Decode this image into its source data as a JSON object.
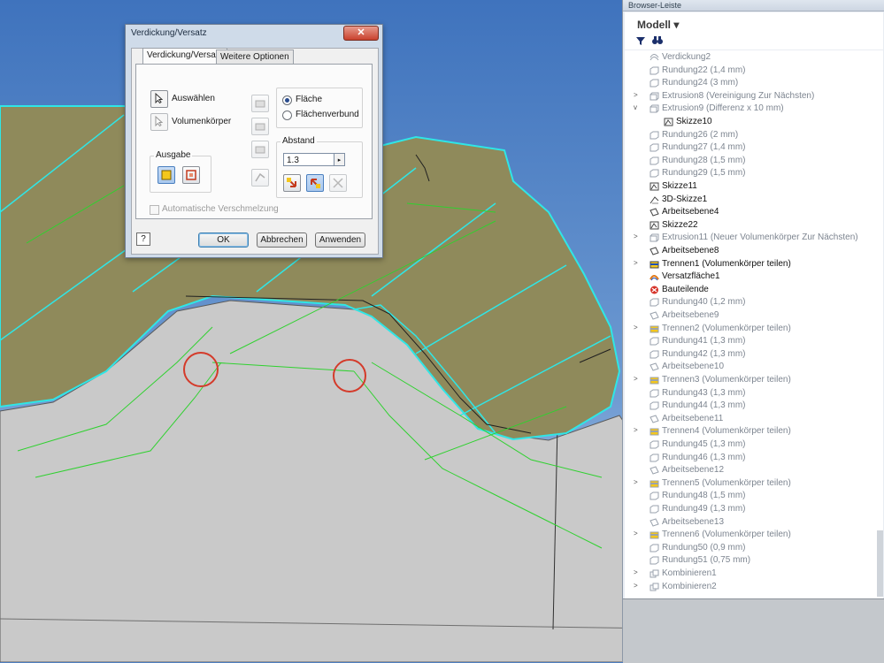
{
  "dialog": {
    "title": "Verdickung/Versatz",
    "close_glyph": "✕",
    "tabs": [
      {
        "label": "Verdickung/Versatz"
      },
      {
        "label": "Weitere Optionen"
      }
    ],
    "select_label": "Auswählen",
    "solid_label": "Volumenkörper",
    "output_group": "Ausgabe",
    "radio_face": "Fläche",
    "radio_quilt": "Flächenverbund",
    "distance_group": "Abstand",
    "distance_value": "1.3",
    "spin_glyph": "▸",
    "auto_blend": "Automatische Verschmelzung",
    "help_glyph": "?",
    "ok": "OK",
    "cancel": "Abbrechen",
    "apply": "Anwenden"
  },
  "browser": {
    "title": "Browser-Leiste",
    "model_dropdown": "Modell ▾",
    "items": [
      {
        "label": "Verdickung2",
        "icon": "thicken-icon",
        "state": "gray",
        "exp": ""
      },
      {
        "label": "Rundung22 (1,4 mm)",
        "icon": "fillet-icon",
        "state": "gray",
        "exp": ""
      },
      {
        "label": "Rundung24 (3 mm)",
        "icon": "fillet-icon",
        "state": "gray",
        "exp": ""
      },
      {
        "label": "Extrusion8 (Vereinigung Zur Nächsten)",
        "icon": "extrude-icon",
        "state": "gray",
        "exp": ">"
      },
      {
        "label": "Extrusion9 (Differenz x 10 mm)",
        "icon": "extrude-icon",
        "state": "gray",
        "exp": "v"
      },
      {
        "label": "Skizze10",
        "icon": "sketch-icon",
        "state": "normal",
        "exp": "",
        "indent": true
      },
      {
        "label": "Rundung26 (2 mm)",
        "icon": "fillet-icon",
        "state": "gray",
        "exp": ""
      },
      {
        "label": "Rundung27 (1,4 mm)",
        "icon": "fillet-icon",
        "state": "gray",
        "exp": ""
      },
      {
        "label": "Rundung28 (1,5 mm)",
        "icon": "fillet-icon",
        "state": "gray",
        "exp": ""
      },
      {
        "label": "Rundung29 (1,5 mm)",
        "icon": "fillet-icon",
        "state": "gray",
        "exp": ""
      },
      {
        "label": "Skizze11",
        "icon": "sketch-icon",
        "state": "normal",
        "exp": ""
      },
      {
        "label": "3D-Skizze1",
        "icon": "sketch3d-icon",
        "state": "normal",
        "exp": ""
      },
      {
        "label": "Arbeitsebene4",
        "icon": "workplane-icon",
        "state": "normal",
        "exp": ""
      },
      {
        "label": "Skizze22",
        "icon": "sketch-icon",
        "state": "normal",
        "exp": ""
      },
      {
        "label": "Extrusion11 (Neuer Volumenkörper Zur Nächsten)",
        "icon": "extrude-icon",
        "state": "gray",
        "exp": ">"
      },
      {
        "label": "Arbeitsebene8",
        "icon": "workplane-icon",
        "state": "normal",
        "exp": ""
      },
      {
        "label": "Trennen1 (Volumenkörper teilen)",
        "icon": "split-icon",
        "state": "normal",
        "exp": ">"
      },
      {
        "label": "Versatzfläche1",
        "icon": "offset-surface-icon",
        "state": "normal",
        "exp": ""
      },
      {
        "label": "Bauteilende",
        "icon": "end-of-part-icon",
        "state": "normal",
        "exp": ""
      },
      {
        "label": "Rundung40 (1,2 mm)",
        "icon": "fillet-icon",
        "state": "gray",
        "exp": ""
      },
      {
        "label": "Arbeitsebene9",
        "icon": "workplane-icon",
        "state": "gray",
        "exp": ""
      },
      {
        "label": "Trennen2 (Volumenkörper teilen)",
        "icon": "split-icon",
        "state": "gray",
        "exp": ">"
      },
      {
        "label": "Rundung41 (1,3 mm)",
        "icon": "fillet-icon",
        "state": "gray",
        "exp": ""
      },
      {
        "label": "Rundung42 (1,3 mm)",
        "icon": "fillet-icon",
        "state": "gray",
        "exp": ""
      },
      {
        "label": "Arbeitsebene10",
        "icon": "workplane-icon",
        "state": "gray",
        "exp": ""
      },
      {
        "label": "Trennen3 (Volumenkörper teilen)",
        "icon": "split-icon",
        "state": "gray",
        "exp": ">"
      },
      {
        "label": "Rundung43 (1,3 mm)",
        "icon": "fillet-icon",
        "state": "gray",
        "exp": ""
      },
      {
        "label": "Rundung44 (1,3 mm)",
        "icon": "fillet-icon",
        "state": "gray",
        "exp": ""
      },
      {
        "label": "Arbeitsebene11",
        "icon": "workplane-icon",
        "state": "gray",
        "exp": ""
      },
      {
        "label": "Trennen4 (Volumenkörper teilen)",
        "icon": "split-icon",
        "state": "gray",
        "exp": ">"
      },
      {
        "label": "Rundung45 (1,3 mm)",
        "icon": "fillet-icon",
        "state": "gray",
        "exp": ""
      },
      {
        "label": "Rundung46 (1,3 mm)",
        "icon": "fillet-icon",
        "state": "gray",
        "exp": ""
      },
      {
        "label": "Arbeitsebene12",
        "icon": "workplane-icon",
        "state": "gray",
        "exp": ""
      },
      {
        "label": "Trennen5 (Volumenkörper teilen)",
        "icon": "split-icon",
        "state": "gray",
        "exp": ">"
      },
      {
        "label": "Rundung48 (1,5 mm)",
        "icon": "fillet-icon",
        "state": "gray",
        "exp": ""
      },
      {
        "label": "Rundung49 (1,3 mm)",
        "icon": "fillet-icon",
        "state": "gray",
        "exp": ""
      },
      {
        "label": "Arbeitsebene13",
        "icon": "workplane-icon",
        "state": "gray",
        "exp": ""
      },
      {
        "label": "Trennen6 (Volumenkörper teilen)",
        "icon": "split-icon",
        "state": "gray",
        "exp": ">"
      },
      {
        "label": "Rundung50 (0,9 mm)",
        "icon": "fillet-icon",
        "state": "gray",
        "exp": ""
      },
      {
        "label": "Rundung51 (0,75 mm)",
        "icon": "fillet-icon",
        "state": "gray",
        "exp": ""
      },
      {
        "label": "Kombinieren1",
        "icon": "combine-icon",
        "state": "gray",
        "exp": ">"
      },
      {
        "label": "Kombinieren2",
        "icon": "combine-icon",
        "state": "gray",
        "exp": ">"
      }
    ]
  },
  "colors": {
    "background": "#4f80c2",
    "olive_surface": "#8f8a5b",
    "gray_body": "#c8c8c8",
    "cyan_edge": "#2fe6e6",
    "green_edge": "#2fd12f",
    "marker_red": "#d43a2a"
  }
}
